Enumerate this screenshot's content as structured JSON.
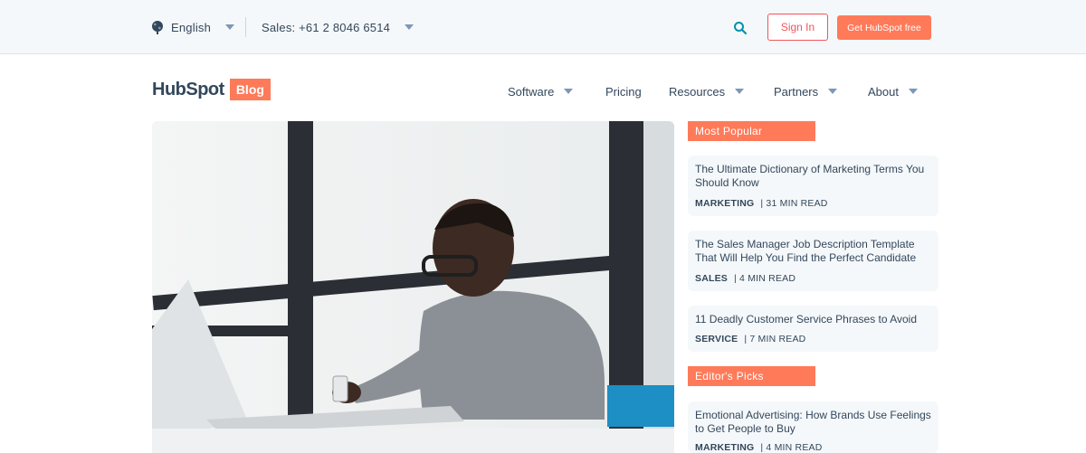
{
  "topbar": {
    "language": "English",
    "sales": "Sales: +61 2 8046 6514",
    "sign_in": "Sign In",
    "get_free": "Get HubSpot free"
  },
  "header": {
    "logo_text": "HubSpot",
    "blog_badge": "Blog",
    "nav": [
      "Software",
      "Pricing",
      "Resources",
      "Partners",
      "About"
    ]
  },
  "sidebar": {
    "most_popular_label": "Most Popular",
    "editors_picks_label": "Editor's Picks",
    "articles": [
      {
        "title": "The Ultimate Dictionary of Marketing Terms You Should Know",
        "category": "MARKETING",
        "read_time": "| 31 MIN READ"
      },
      {
        "title": "The Sales Manager Job Description Template That Will Help You Find the Perfect Candidate",
        "category": "SALES",
        "read_time": "| 4 MIN READ"
      },
      {
        "title": "11 Deadly Customer Service Phrases to Avoid",
        "category": "SERVICE",
        "read_time": "| 7 MIN READ"
      },
      {
        "title": "Emotional Advertising: How Brands Use Feelings to Get People to Buy",
        "category": "MARKETING",
        "read_time": "| 4 MIN READ"
      }
    ]
  },
  "colors": {
    "accent": "#ff7a59",
    "signin_border": "#f2545b",
    "text": "#33475b",
    "topbar_bg": "#f5f8fa",
    "card_bg": "#f5f8fa",
    "search_icon": "#0091ae"
  },
  "icons": [
    "globe-icon",
    "chevron-down-icon",
    "search-icon"
  ]
}
